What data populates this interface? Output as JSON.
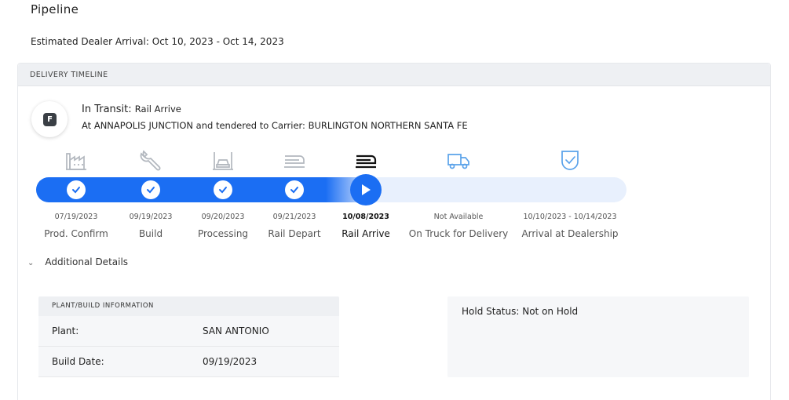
{
  "page": {
    "title": "Pipeline",
    "eta_label": "Estimated Dealer Arrival:",
    "eta_value": "Oct 10, 2023 - Oct 14, 2023"
  },
  "timeline": {
    "header": "DELIVERY TIMELINE",
    "badge_letter": "F",
    "status_label": "In Transit:",
    "status_sub": "Rail Arrive",
    "status_detail": "At ANNAPOLIS JUNCTION and tendered to Carrier: BURLINGTON NORTHERN SANTA FE",
    "progress_fraction": 0.57,
    "steps": [
      {
        "date": "07/19/2023",
        "label": "Prod. Confirm",
        "state": "complete",
        "icon": "factory-icon"
      },
      {
        "date": "09/19/2023",
        "label": "Build",
        "state": "complete",
        "icon": "wrench-icon"
      },
      {
        "date": "09/20/2023",
        "label": "Processing",
        "state": "complete",
        "icon": "car-lift-icon"
      },
      {
        "date": "09/21/2023",
        "label": "Rail Depart",
        "state": "complete",
        "icon": "train-icon"
      },
      {
        "date": "10/08/2023",
        "label": "Rail Arrive",
        "state": "current",
        "icon": "train-icon"
      },
      {
        "date": "Not Available",
        "label": "On Truck for Delivery",
        "state": "pending",
        "icon": "truck-icon"
      },
      {
        "date": "10/10/2023 - 10/14/2023",
        "label": "Arrival at Dealership",
        "state": "pending",
        "icon": "shield-check-icon"
      }
    ]
  },
  "details": {
    "toggle_label": "Additional Details",
    "plant_header": "PLANT/BUILD INFORMATION",
    "plant_label": "Plant:",
    "plant_value": "SAN ANTONIO",
    "build_date_label": "Build Date:",
    "build_date_value": "09/19/2023",
    "hold_status": "Hold Status: Not on Hold"
  },
  "colors": {
    "accent": "#1b6ef3",
    "track_bg": "#e8f0fd",
    "inactive_icon": "#b3b8bf",
    "pending_icon": "#5aa2ea"
  }
}
